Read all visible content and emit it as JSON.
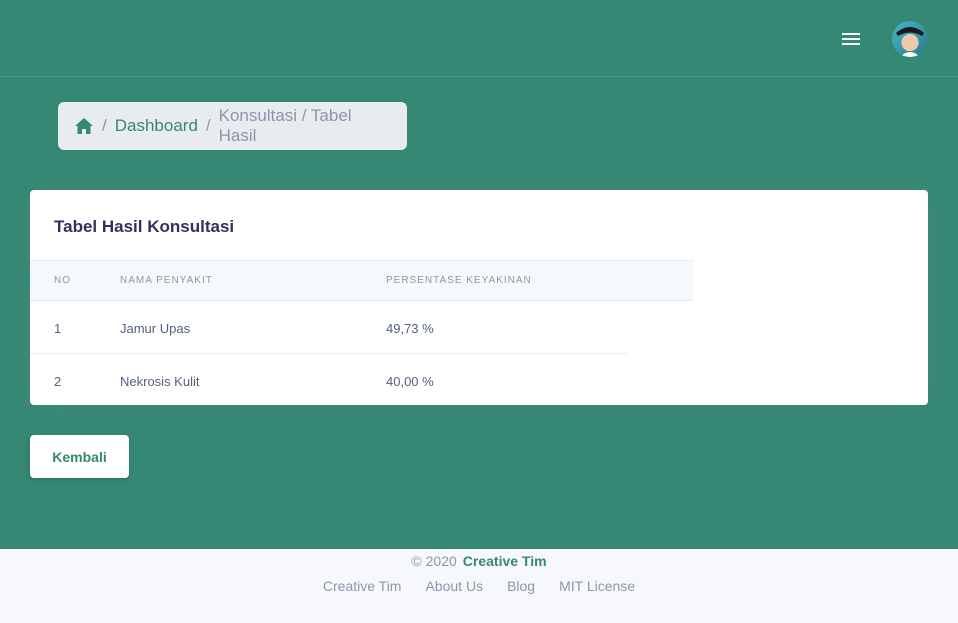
{
  "breadcrumb": {
    "home_icon": "home-icon",
    "items": [
      "Dashboard",
      "Konsultasi / Tabel Hasil"
    ],
    "separator": "/"
  },
  "card": {
    "title": "Tabel Hasil Konsultasi",
    "columns": [
      "NO",
      "NAMA PENYAKIT",
      "PERSENTASE KEYAKINAN"
    ],
    "rows": [
      {
        "no": "1",
        "penyakit": "Jamur Upas",
        "persentase": "49,73 %"
      },
      {
        "no": "2",
        "penyakit": "Nekrosis Kulit",
        "persentase": "40,00 %"
      }
    ]
  },
  "back_button": "Kembali",
  "footer": {
    "copyright": "© 2020",
    "brand": "Creative Tim",
    "links": [
      "Creative Tim",
      "About Us",
      "Blog",
      "MIT License"
    ]
  },
  "colors": {
    "primary": "#358873",
    "muted": "#8898aa",
    "heading": "#32325d"
  }
}
